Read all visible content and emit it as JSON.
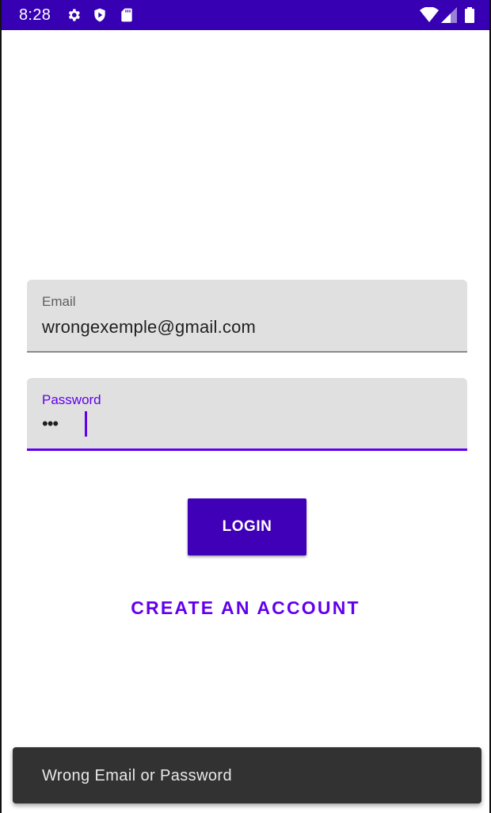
{
  "status_bar": {
    "time": "8:28",
    "background": "#3700b3",
    "left_icons": [
      "settings-icon",
      "shield-play-icon",
      "sd-card-icon"
    ],
    "right_icons": [
      "wifi-icon",
      "signal-icon",
      "battery-icon"
    ]
  },
  "login_form": {
    "email": {
      "label": "Email",
      "value": "wrongexemple@gmail.com"
    },
    "password": {
      "label": "Password",
      "value_masked": "•••"
    },
    "login_label": "LOGIN",
    "create_account_label": "CREATE AN ACCOUNT"
  },
  "snackbar": {
    "message": "Wrong Email or Password"
  },
  "colors": {
    "accent": "#6200ee",
    "button": "#3f00b7",
    "field_bg": "#e0e0e0",
    "snackbar_bg": "#323232"
  }
}
